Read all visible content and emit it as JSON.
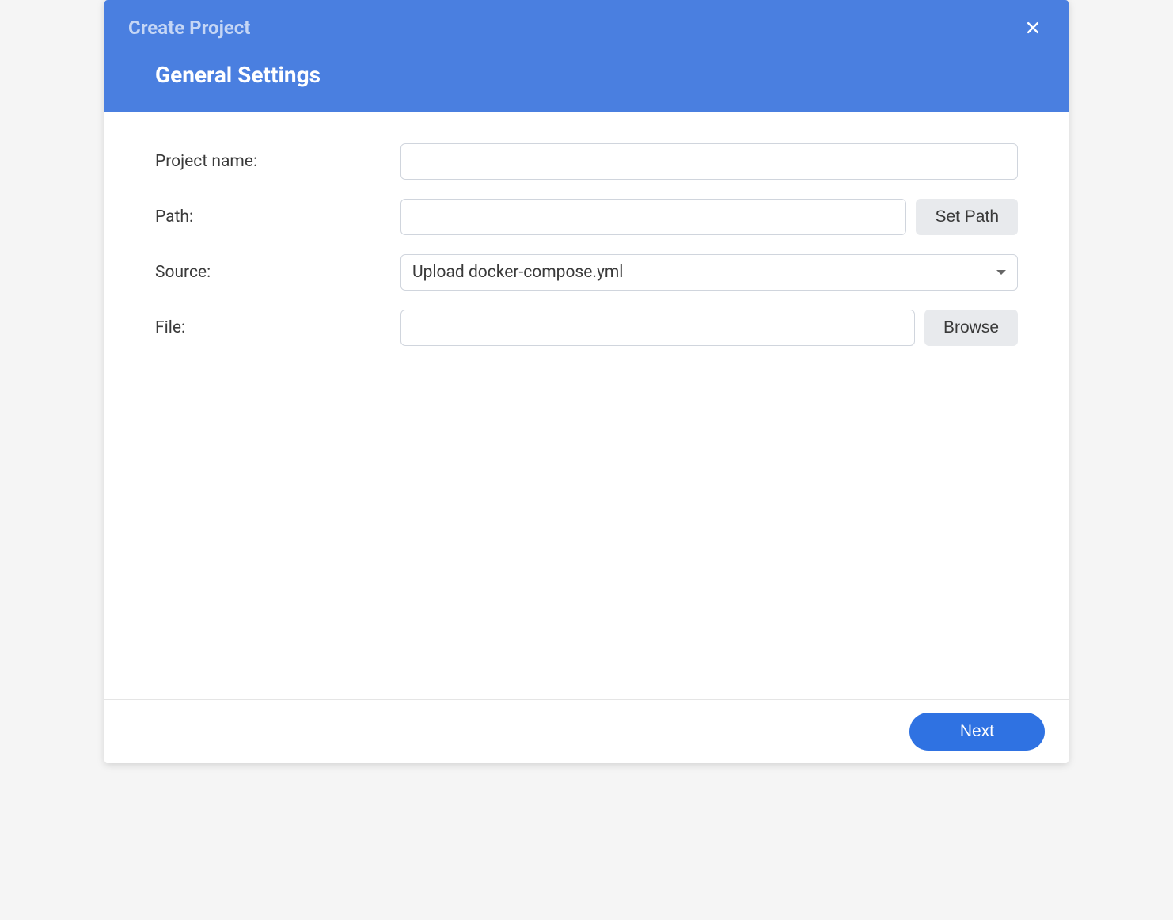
{
  "dialog": {
    "title": "Create Project",
    "section_title": "General Settings"
  },
  "form": {
    "project_name": {
      "label": "Project name:",
      "value": ""
    },
    "path": {
      "label": "Path:",
      "value": "",
      "button_label": "Set Path"
    },
    "source": {
      "label": "Source:",
      "selected": "Upload docker-compose.yml"
    },
    "file": {
      "label": "File:",
      "value": "",
      "button_label": "Browse"
    }
  },
  "footer": {
    "next_label": "Next"
  }
}
